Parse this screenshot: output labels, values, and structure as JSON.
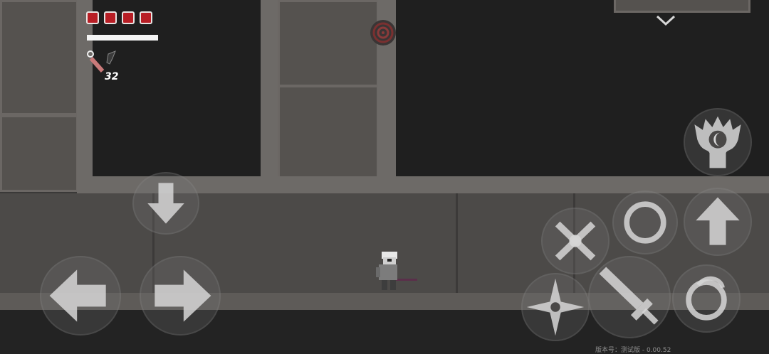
{
  "hud": {
    "health": {
      "current": 4,
      "max": 4,
      "color": "#b81e25"
    },
    "stamina_fill": 1.0,
    "weapon_icon": "lighter-and-blade-icon",
    "ammo_count": "32",
    "target_marker_icon": "spiral-target-icon",
    "dropdown_icon": "chevron-down-icon"
  },
  "controls": {
    "move_left_icon": "arrow-left-icon",
    "move_right_icon": "arrow-right-icon",
    "move_down_icon": "arrow-down-icon",
    "jump_icon": "arrow-up-icon",
    "dash_icon": "circle-ring-icon",
    "parry_icon": "crossed-swords-icon",
    "attack_icon": "sword-icon",
    "throw_icon": "shuriken-icon",
    "spin_icon": "spiral-icon",
    "special_icon": "crescent-emblem-icon"
  },
  "footer": {
    "version_text": "版本号：测试版 - 0.00.52"
  }
}
